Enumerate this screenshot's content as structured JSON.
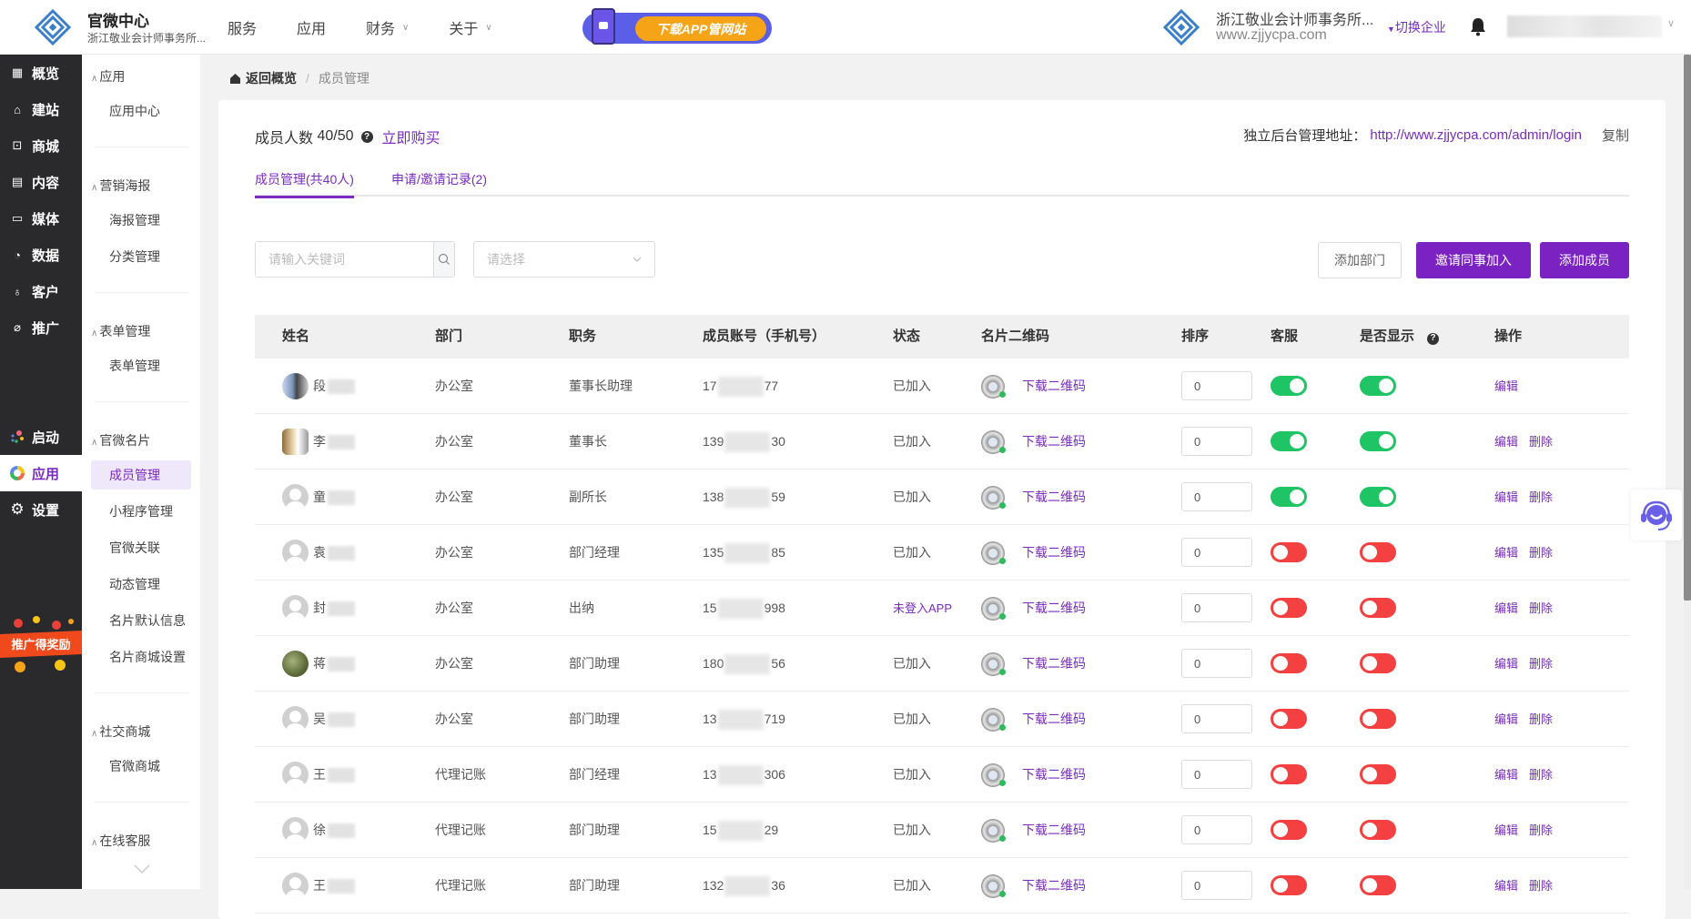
{
  "header": {
    "brand_title": "官微中心",
    "brand_subtitle": "浙江敬业会计师事务所...",
    "nav": [
      {
        "label": "服务",
        "has_dropdown": false
      },
      {
        "label": "应用",
        "has_dropdown": false
      },
      {
        "label": "财务",
        "has_dropdown": true
      },
      {
        "label": "关于",
        "has_dropdown": true
      }
    ],
    "promo_label": "下载APP管网站",
    "enterprise_name": "浙江敬业会计师事务所...",
    "enterprise_url": "www.zjjycpa.com",
    "switch_label": "切换企业",
    "icons": {
      "bell": "bell-icon",
      "logo": "diamond-logo-icon"
    }
  },
  "sidebar": {
    "items": [
      {
        "label": "概览",
        "icon": "chart-board-icon",
        "glyph": "▦"
      },
      {
        "label": "建站",
        "icon": "home-icon",
        "glyph": "⌂"
      },
      {
        "label": "商城",
        "icon": "cart-icon",
        "glyph": "⊡"
      },
      {
        "label": "内容",
        "icon": "document-icon",
        "glyph": "▤"
      },
      {
        "label": "媒体",
        "icon": "video-icon",
        "glyph": "▭"
      },
      {
        "label": "数据",
        "icon": "pie-chart-icon",
        "glyph": "◔"
      },
      {
        "label": "客户",
        "icon": "user-icon",
        "glyph": "♁"
      },
      {
        "label": "推广",
        "icon": "paperclip-icon",
        "glyph": "⌀"
      },
      {
        "label": "启动",
        "icon": "dots-icon",
        "glyph": "⁘"
      },
      {
        "label": "应用",
        "icon": "apps-ring-icon",
        "glyph": "◎",
        "active": true
      },
      {
        "label": "设置",
        "icon": "gear-icon",
        "glyph": "⚙"
      }
    ],
    "promo_label": "推广得奖励"
  },
  "submenu": {
    "groups": [
      {
        "title": "应用",
        "items": [
          "应用中心"
        ]
      },
      {
        "title": "营销海报",
        "items": [
          "海报管理",
          "分类管理"
        ]
      },
      {
        "title": "表单管理",
        "items": [
          "表单管理"
        ]
      },
      {
        "title": "官微名片",
        "items": [
          "成员管理",
          "小程序管理",
          "官微关联",
          "动态管理",
          "名片默认信息",
          "名片商城设置"
        ],
        "active": "成员管理"
      },
      {
        "title": "社交商城",
        "items": [
          "官微商城"
        ]
      },
      {
        "title": "在线客服",
        "items": []
      }
    ]
  },
  "breadcrumb": {
    "home": "返回概览",
    "current": "成员管理"
  },
  "summary": {
    "label": "成员人数",
    "count": "40/50",
    "buy_label": "立即购买",
    "admin_label": "独立后台管理地址：",
    "admin_url": "http://www.zjjycpa.com/admin/login",
    "copy_label": "复制"
  },
  "tabs": [
    {
      "label": "成员管理(共40人)",
      "active": true
    },
    {
      "label": "申请/邀请记录(2)",
      "active": false
    }
  ],
  "filters": {
    "search_placeholder": "请输入关键词",
    "select_placeholder": "请选择"
  },
  "actions": {
    "add_department": "添加部门",
    "invite": "邀请同事加入",
    "add_member": "添加成员"
  },
  "table": {
    "columns": [
      "姓名",
      "部门",
      "职务",
      "成员账号（手机号）",
      "状态",
      "名片二维码",
      "排序",
      "客服",
      "是否显示",
      "操作"
    ],
    "qr_link_label": "下载二维码",
    "edit_label": "编辑",
    "delete_label": "删除",
    "rows": [
      {
        "name": "段",
        "avatar": "photo1",
        "dept": "办公室",
        "title": "董事长助理",
        "phone_prefix": "17",
        "phone_suffix": "77",
        "status": "已加入",
        "sort": "0",
        "service": true,
        "show": true,
        "deletable": false
      },
      {
        "name": "李",
        "avatar": "photo2",
        "dept": "办公室",
        "title": "董事长",
        "phone_prefix": "139",
        "phone_suffix": "30",
        "status": "已加入",
        "sort": "0",
        "service": true,
        "show": true,
        "deletable": true
      },
      {
        "name": "童",
        "avatar": "default",
        "dept": "办公室",
        "title": "副所长",
        "phone_prefix": "138",
        "phone_suffix": "59",
        "status": "已加入",
        "sort": "0",
        "service": true,
        "show": true,
        "deletable": true
      },
      {
        "name": "袁",
        "avatar": "default",
        "dept": "办公室",
        "title": "部门经理",
        "phone_prefix": "135",
        "phone_suffix": "85",
        "status": "已加入",
        "sort": "0",
        "service": false,
        "show": false,
        "deletable": true
      },
      {
        "name": "封",
        "avatar": "default",
        "dept": "办公室",
        "title": "出纳",
        "phone_prefix": "15",
        "phone_suffix": "998",
        "status": "未登入APP",
        "pending": true,
        "sort": "0",
        "service": false,
        "show": false,
        "deletable": true
      },
      {
        "name": "蒋",
        "avatar": "photo3",
        "dept": "办公室",
        "title": "部门助理",
        "phone_prefix": "180",
        "phone_suffix": "56",
        "status": "已加入",
        "sort": "0",
        "service": false,
        "show": false,
        "deletable": true
      },
      {
        "name": "吴",
        "avatar": "default",
        "dept": "办公室",
        "title": "部门助理",
        "phone_prefix": "13",
        "phone_suffix": "719",
        "status": "已加入",
        "sort": "0",
        "service": false,
        "show": false,
        "deletable": true
      },
      {
        "name": "王",
        "avatar": "default",
        "dept": "代理记账",
        "title": "部门经理",
        "phone_prefix": "13",
        "phone_suffix": "306",
        "status": "已加入",
        "sort": "0",
        "service": false,
        "show": false,
        "deletable": true
      },
      {
        "name": "徐",
        "avatar": "default",
        "dept": "代理记账",
        "title": "部门助理",
        "phone_prefix": "15",
        "phone_suffix": "29",
        "status": "已加入",
        "sort": "0",
        "service": false,
        "show": false,
        "deletable": true
      },
      {
        "name": "王",
        "avatar": "default",
        "dept": "代理记账",
        "title": "部门助理",
        "phone_prefix": "132",
        "phone_suffix": "36",
        "status": "已加入",
        "sort": "0",
        "service": false,
        "show": false,
        "deletable": true
      }
    ]
  },
  "colors": {
    "accent": "#7a22c2",
    "toggle_on": "#1fc565",
    "toggle_off": "#f44040",
    "sidebar_bg": "#2a2a2c"
  }
}
